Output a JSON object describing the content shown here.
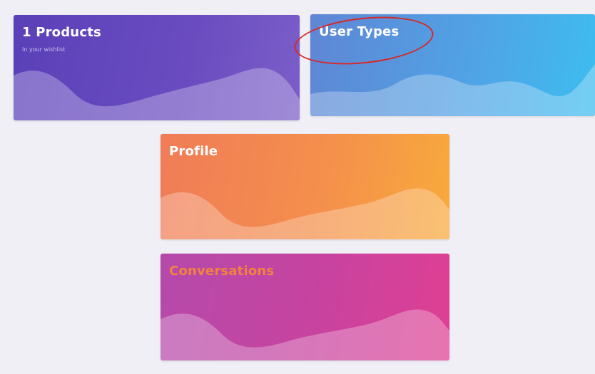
{
  "cards": {
    "products": {
      "title": "1 Products",
      "subtitle": "In your wishlist"
    },
    "user_types": {
      "title": "User Types"
    },
    "profile": {
      "title": "Profile"
    },
    "conversations": {
      "title": "Conversations"
    }
  },
  "colors": {
    "products": "#5a40b8",
    "user_types": "#4fa5e6",
    "profile": "#f48f4c",
    "conversations": "#c8439f",
    "annotation": "#d62828",
    "background": "#f0eff6"
  }
}
